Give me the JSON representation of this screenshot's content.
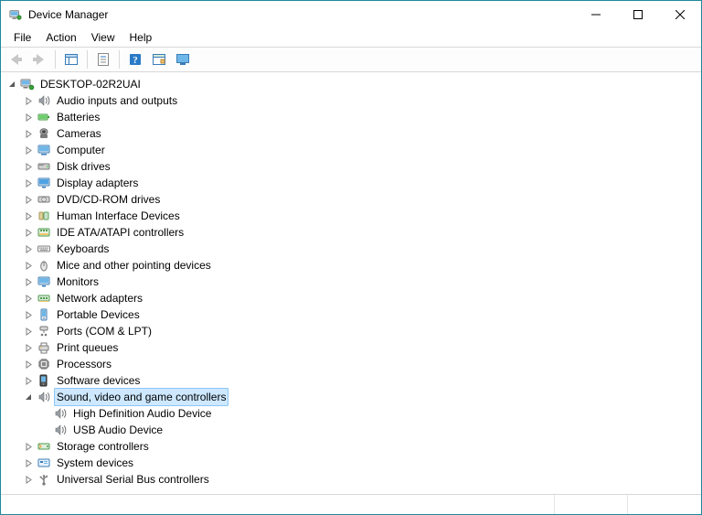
{
  "window": {
    "title": "Device Manager"
  },
  "menubar": [
    {
      "id": "file",
      "label": "File"
    },
    {
      "id": "action",
      "label": "Action"
    },
    {
      "id": "view",
      "label": "View"
    },
    {
      "id": "help",
      "label": "Help"
    }
  ],
  "toolbar": [
    {
      "id": "back",
      "icon": "arrow-left-icon",
      "enabled": false
    },
    {
      "id": "forward",
      "icon": "arrow-right-icon",
      "enabled": false
    },
    {
      "id": "sep"
    },
    {
      "id": "show-hide",
      "icon": "panel-icon",
      "enabled": true
    },
    {
      "id": "sep"
    },
    {
      "id": "properties",
      "icon": "properties-icon",
      "enabled": true
    },
    {
      "id": "sep"
    },
    {
      "id": "help",
      "icon": "help-icon",
      "enabled": true
    },
    {
      "id": "devices",
      "icon": "devices-tool-icon",
      "enabled": true
    },
    {
      "id": "monitor",
      "icon": "monitor-tool-icon",
      "enabled": true
    }
  ],
  "tree": {
    "root": {
      "label": "DESKTOP-02R2UAI",
      "icon": "computer-root-icon",
      "expanded": true,
      "selected": false
    },
    "categories": [
      {
        "label": "Audio inputs and outputs",
        "icon": "speaker-icon",
        "expanded": false,
        "selected": false
      },
      {
        "label": "Batteries",
        "icon": "battery-icon",
        "expanded": false,
        "selected": false
      },
      {
        "label": "Cameras",
        "icon": "camera-icon",
        "expanded": false,
        "selected": false
      },
      {
        "label": "Computer",
        "icon": "computer-icon",
        "expanded": false,
        "selected": false
      },
      {
        "label": "Disk drives",
        "icon": "disk-icon",
        "expanded": false,
        "selected": false
      },
      {
        "label": "Display adapters",
        "icon": "display-icon",
        "expanded": false,
        "selected": false
      },
      {
        "label": "DVD/CD-ROM drives",
        "icon": "cdrom-icon",
        "expanded": false,
        "selected": false
      },
      {
        "label": "Human Interface Devices",
        "icon": "hid-icon",
        "expanded": false,
        "selected": false
      },
      {
        "label": "IDE ATA/ATAPI controllers",
        "icon": "ide-icon",
        "expanded": false,
        "selected": false
      },
      {
        "label": "Keyboards",
        "icon": "keyboard-icon",
        "expanded": false,
        "selected": false
      },
      {
        "label": "Mice and other pointing devices",
        "icon": "mouse-icon",
        "expanded": false,
        "selected": false
      },
      {
        "label": "Monitors",
        "icon": "monitor-icon",
        "expanded": false,
        "selected": false
      },
      {
        "label": "Network adapters",
        "icon": "network-icon",
        "expanded": false,
        "selected": false
      },
      {
        "label": "Portable Devices",
        "icon": "portable-icon",
        "expanded": false,
        "selected": false
      },
      {
        "label": "Ports (COM & LPT)",
        "icon": "port-icon",
        "expanded": false,
        "selected": false
      },
      {
        "label": "Print queues",
        "icon": "printer-icon",
        "expanded": false,
        "selected": false
      },
      {
        "label": "Processors",
        "icon": "cpu-icon",
        "expanded": false,
        "selected": false
      },
      {
        "label": "Software devices",
        "icon": "software-icon",
        "expanded": false,
        "selected": false
      },
      {
        "label": "Sound, video and game controllers",
        "icon": "speaker-icon",
        "expanded": true,
        "selected": true,
        "children": [
          {
            "label": "High Definition Audio Device",
            "icon": "speaker-icon"
          },
          {
            "label": "USB Audio Device",
            "icon": "speaker-icon"
          }
        ]
      },
      {
        "label": "Storage controllers",
        "icon": "storage-icon",
        "expanded": false,
        "selected": false
      },
      {
        "label": "System devices",
        "icon": "system-icon",
        "expanded": false,
        "selected": false
      },
      {
        "label": "Universal Serial Bus controllers",
        "icon": "usb-icon",
        "expanded": false,
        "selected": false
      }
    ]
  }
}
